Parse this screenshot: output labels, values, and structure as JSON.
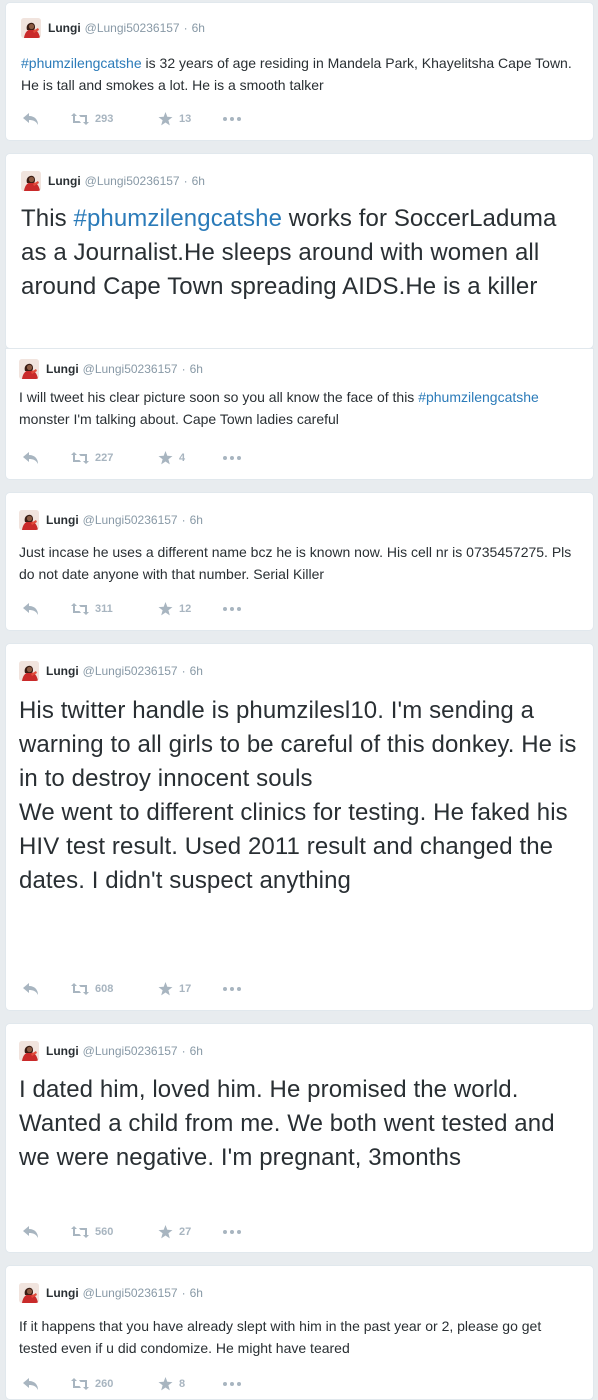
{
  "colors": {
    "background": "#e8ecef",
    "card": "#ffffff",
    "text": "#292f33",
    "muted": "#8899a6",
    "hashtag": "#2b7bb9",
    "icon": "#a8b5c0"
  },
  "icons": {
    "reply": "reply-icon",
    "retweet": "retweet-icon",
    "favorite": "star-icon",
    "more": "more-icon"
  },
  "tweets": [
    {
      "name": "Lungi",
      "handle": "@Lungi50236157",
      "sep": "·",
      "time": "6h",
      "hashtag": "#phumzilengcatshe",
      "text": " is 32 years of age residing in Mandela Park, Khayelitsha Cape Town. He is tall and smokes a lot. He is a smooth talker",
      "retweets": "293",
      "favorites": "13"
    },
    {
      "name": "Lungi",
      "handle": "@Lungi50236157",
      "sep": "·",
      "time": "6h",
      "prefix": "This ",
      "hashtag": "#phumzilengcatshe",
      "text": " works for SoccerLaduma as a Journalist.He sleeps around with women all around Cape Town spreading AIDS.He is a killer"
    },
    {
      "name": "Lungi",
      "handle": "@Lungi50236157",
      "sep": "·",
      "time": "6h",
      "prefix": "I will tweet his clear picture soon so you all know the face of this ",
      "hashtag": "#phumzilengcatshe",
      "text": " monster I'm talking about. Cape Town ladies careful",
      "retweets": "227",
      "favorites": "4"
    },
    {
      "name": "Lungi",
      "handle": "@Lungi50236157",
      "sep": "·",
      "time": "6h",
      "text": "Just incase he uses a different name bcz he is known now. His cell nr is 0735457275. Pls do not date anyone with that number. Serial Killer",
      "retweets": "311",
      "favorites": "12"
    },
    {
      "name": "Lungi",
      "handle": "@Lungi50236157",
      "sep": "·",
      "time": "6h",
      "text": "His twitter handle is phumzilesl10. I'm sending a warning to all girls to be careful of this donkey. He is in to destroy innocent souls\nWe went to different clinics for testing. He faked his HIV test result. Used 2011 result and changed the dates. I didn't suspect anything",
      "retweets": "608",
      "favorites": "17"
    },
    {
      "name": "Lungi",
      "handle": "@Lungi50236157",
      "sep": "·",
      "time": "6h",
      "text": "I dated him, loved him. He promised the world. Wanted a child from me. We both went tested and we were negative. I'm pregnant, 3months",
      "retweets": "560",
      "favorites": "27"
    },
    {
      "name": "Lungi",
      "handle": "@Lungi50236157",
      "sep": "·",
      "time": "6h",
      "text": "If it happens that you have already slept with him in the past year or 2, please go get tested even if u did condomize. He might have teared",
      "retweets": "260",
      "favorites": "8"
    }
  ]
}
